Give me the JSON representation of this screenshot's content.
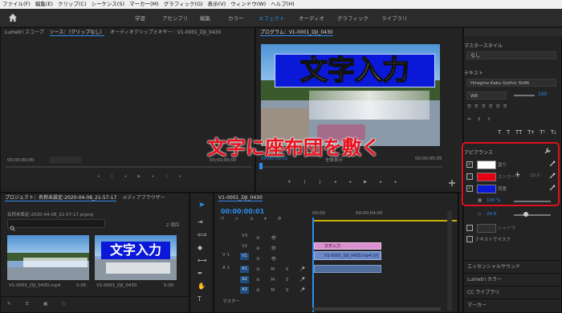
{
  "menu": [
    "ファイル(F)",
    "編集(E)",
    "クリップ(C)",
    "シーケンス(S)",
    "マーカー(M)",
    "グラフィック(G)",
    "表示(V)",
    "ウィンドウ(W)",
    "ヘルプ(H)"
  ],
  "workspaces": [
    "学習",
    "アセンブリ",
    "編集",
    "カラー",
    "エフェクト",
    "オーディオ",
    "グラフィック",
    "ライブラリ"
  ],
  "active_workspace": "エフェクト",
  "lumetri_tab": "Lumetri スコープ",
  "source_tab": "ソース：（クリップなし）",
  "audio_mixer_tab": "オーディオクリップミキサー：V1-0001_DJI_0430",
  "source_timecode_left": "00;00;00;00",
  "source_timecode_right": "00;00;00;00",
  "program": {
    "title": "プログラム：V1-0001_DJI_0430",
    "video_title": "文字入力",
    "timecode": "00:00:00:01",
    "fit": "全体表示",
    "duration": "00:00:05:05"
  },
  "overlay_caption": "文字に座布団を敷く",
  "project": {
    "tab": "プロジェクト：名称未設定-2020-04-08_21-57-17",
    "media_tab": "メディアブラウザー",
    "file": "名称未設定-2020-04-08_21-57-17.prproj",
    "count": "2 項目",
    "thumb1_name": "V1-0001_DJI_0430.mp4",
    "thumb1_dur": "5:05",
    "thumb2_title": "文字入力",
    "thumb2_name": "V1-0001_DJI_0430",
    "thumb2_dur": "5:05"
  },
  "timeline": {
    "title": "V1-0001_DJI_0430",
    "timecode": "00:00:00:01",
    "ruler": [
      "00:00",
      "00:00:04:00"
    ],
    "tracks": [
      "V3",
      "V2",
      "V1",
      "A1",
      "A2",
      "A3"
    ],
    "text_clip": "文字入力",
    "video_clip": "V1-0001_DJI_0430.mp4 [V]",
    "master_label": "マスター"
  },
  "essential": {
    "master_style_label": "マスタースタイル",
    "master_style_value": "なし",
    "text_label": "テキスト",
    "font": "Hiragino Kaku Gothic StdN",
    "weight": "W8",
    "size": "160",
    "tt_buttons": [
      "T",
      "T",
      "TT",
      "Tт",
      "T¹",
      "T₁"
    ],
    "appearance_label": "アピアランス",
    "fill_label": "塗り",
    "fill_color": "#ffffff",
    "stroke_label": "ストローク",
    "stroke_color": "#e60012",
    "stroke_value": "10.0",
    "bg_label": "背景",
    "bg_color": "#0a18d8",
    "bg_opacity": "100 %",
    "bg_size": "29.0",
    "shadow_label": "シャドウ",
    "mask_label": "テキストでマスク",
    "tabs": [
      "エッセンシャルサウンド",
      "Lumetri カラー",
      "CC ライブラリ",
      "マーカー"
    ]
  },
  "colors": {
    "accent": "#2d8ceb",
    "highlight_border": "#e0101c",
    "caption": "#e8101c",
    "text_clip": "#d98fd0",
    "video_clip": "#6b88c8",
    "audio_clip": "#4f6e9e"
  }
}
